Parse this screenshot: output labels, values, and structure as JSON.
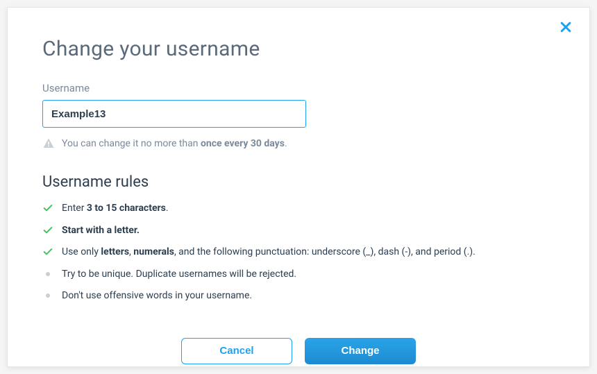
{
  "dialog": {
    "title": "Change your username",
    "field_label": "Username",
    "username_value": "Example13",
    "warning_prefix": "You can change it no more than ",
    "warning_bold": "once every 30 days",
    "warning_suffix": ".",
    "rules_title": "Username rules",
    "rules": [
      {
        "type": "check",
        "html": "Enter <span class=\"bold\">3 to 15 characters</span>."
      },
      {
        "type": "check",
        "html": "<span class=\"bold\">Start with a letter.</span>"
      },
      {
        "type": "check",
        "html": "Use only <span class=\"bold\">letters</span>, <span class=\"bold\">numerals</span>, and the following punctuation: underscore (_), dash (-), and period (.)."
      },
      {
        "type": "bullet",
        "html": "Try to be unique. Duplicate usernames will be rejected."
      },
      {
        "type": "bullet",
        "html": "Don't use offensive words in your username."
      }
    ],
    "cancel_label": "Cancel",
    "change_label": "Change"
  }
}
